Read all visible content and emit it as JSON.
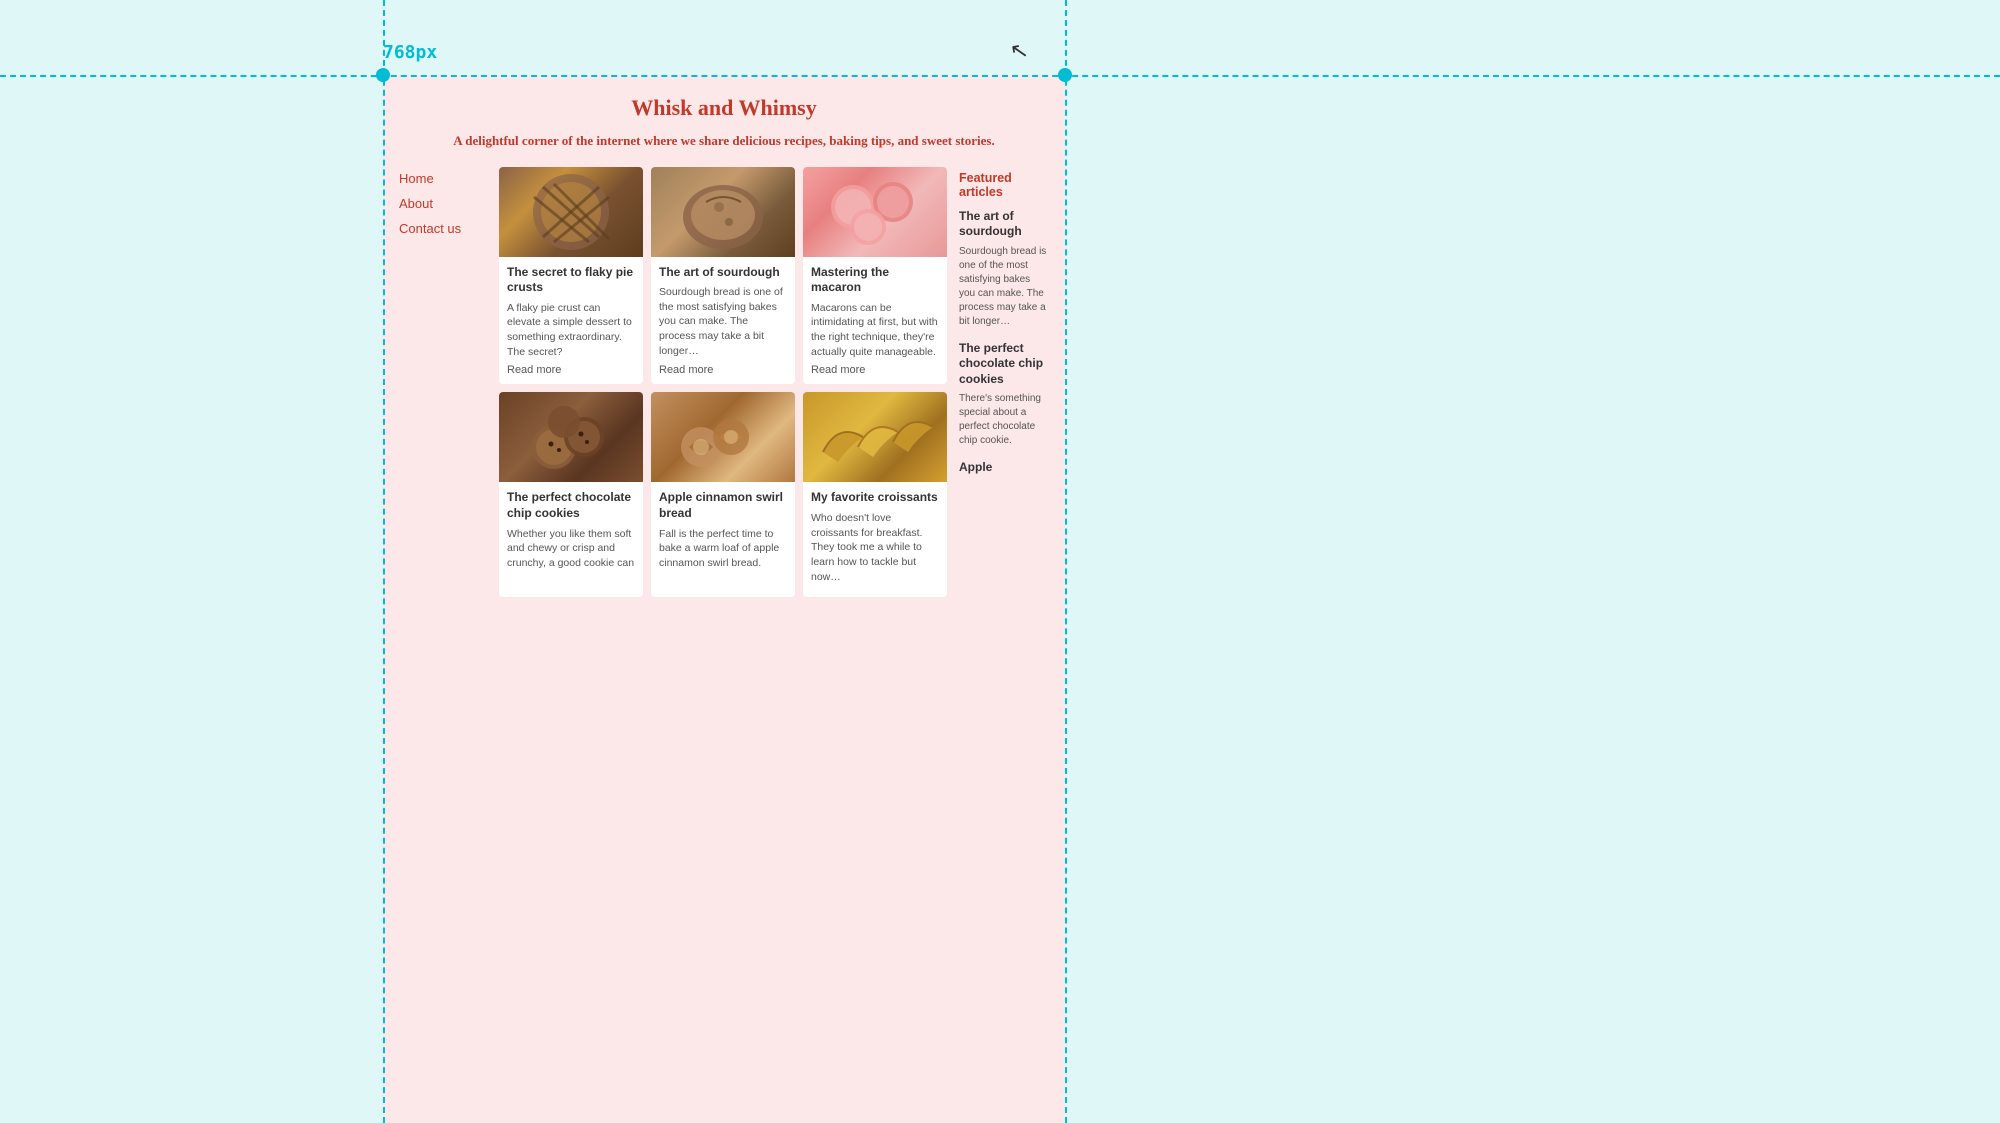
{
  "dimension_label": "768px",
  "site": {
    "title": "Whisk and Whimsy",
    "tagline": "A delightful corner of the internet where we share delicious recipes, baking tips, and sweet stories.",
    "nav": [
      {
        "label": "Home",
        "href": "#"
      },
      {
        "label": "About",
        "href": "#"
      },
      {
        "label": "Contact us",
        "href": "#"
      }
    ],
    "articles": [
      {
        "id": "pie-crust",
        "title": "The secret to flaky pie crusts",
        "excerpt": "A flaky pie crust can elevate a simple dessert to something extraordinary. The secret?",
        "readmore": "Read more",
        "img_type": "pie"
      },
      {
        "id": "sourdough",
        "title": "The art of sourdough",
        "excerpt": "Sourdough bread is one of the most satisfying bakes you can make. The process may take a bit longer…",
        "readmore": "Read more",
        "img_type": "sourdough"
      },
      {
        "id": "macaron",
        "title": "Mastering the macaron",
        "excerpt": "Macarons can be intimidating at first, but with the right technique, they're actually quite manageable.",
        "readmore": "Read more",
        "img_type": "macaron"
      },
      {
        "id": "cookies",
        "title": "The perfect chocolate chip cookies",
        "excerpt": "Whether you like them soft and chewy or crisp and crunchy, a good cookie can",
        "readmore": "",
        "img_type": "cookies"
      },
      {
        "id": "cinnamon",
        "title": "Apple cinnamon swirl bread",
        "excerpt": "Fall is the perfect time to bake a warm loaf of apple cinnamon swirl bread.",
        "readmore": "",
        "img_type": "cinnamon"
      },
      {
        "id": "croissants",
        "title": "My favorite croissants",
        "excerpt": "Who doesn't love croissants for breakfast. They took me a while to learn how to tackle but now…",
        "readmore": "",
        "img_type": "croissant"
      }
    ],
    "featured": {
      "title": "Featured articles",
      "items": [
        {
          "title": "The art of sourdough",
          "excerpt": "Sourdough bread is one of the most satisfying bakes you can make. The process may take a bit longer…"
        },
        {
          "title": "The perfect chocolate chip cookies",
          "excerpt": "There's something special about a perfect chocolate chip cookie."
        },
        {
          "title": "Apple",
          "excerpt": ""
        }
      ]
    }
  }
}
